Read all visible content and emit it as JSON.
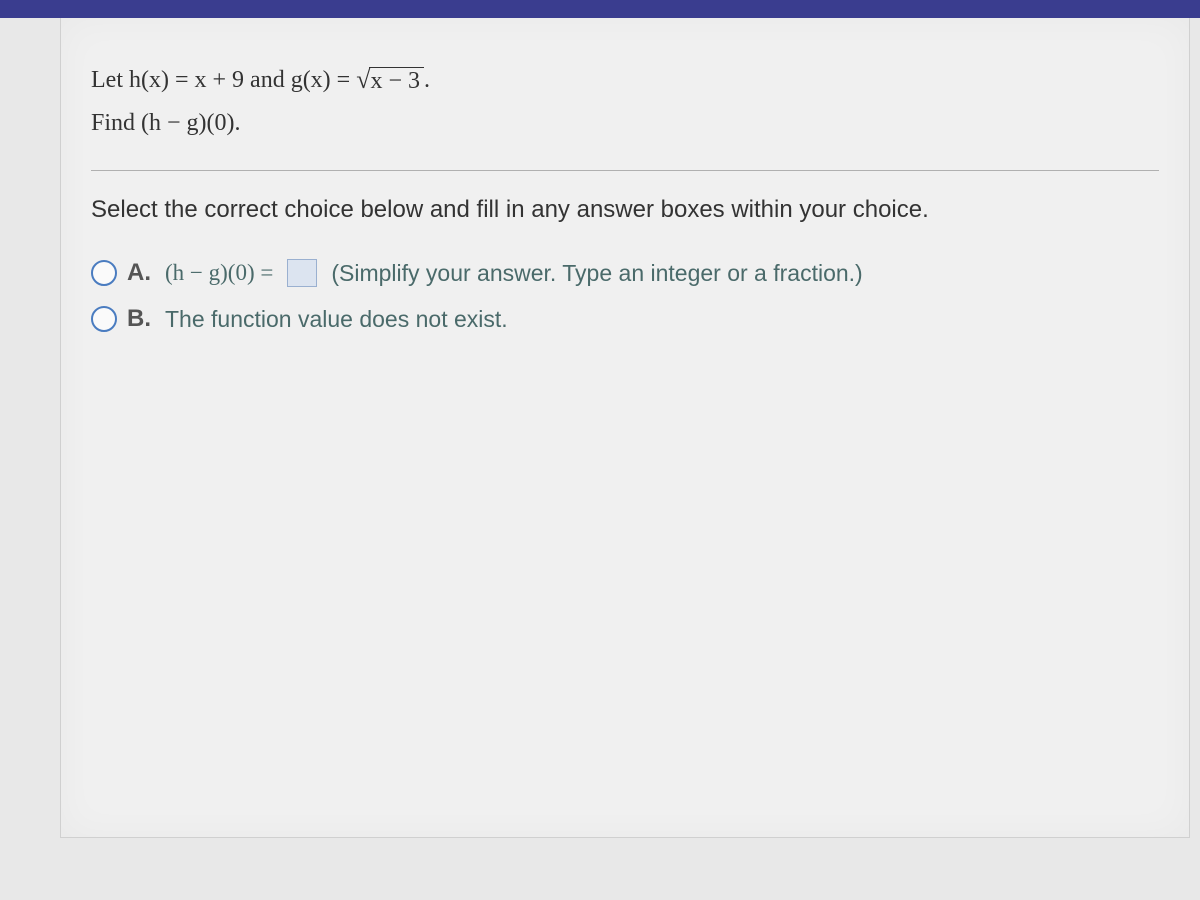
{
  "problem": {
    "line1_prefix": "Let h(x) = x + 9 and g(x) = ",
    "sqrt_expr": "x − 3",
    "line1_suffix": ".",
    "line2": "Find (h − g)(0)."
  },
  "instruction": "Select the correct choice below and fill in any answer boxes within your choice.",
  "choices": {
    "a": {
      "label": "A.",
      "expr": "(h − g)(0) =",
      "hint": "(Simplify your answer. Type an integer or a fraction.)"
    },
    "b": {
      "label": "B.",
      "text": "The function value does not exist."
    }
  }
}
